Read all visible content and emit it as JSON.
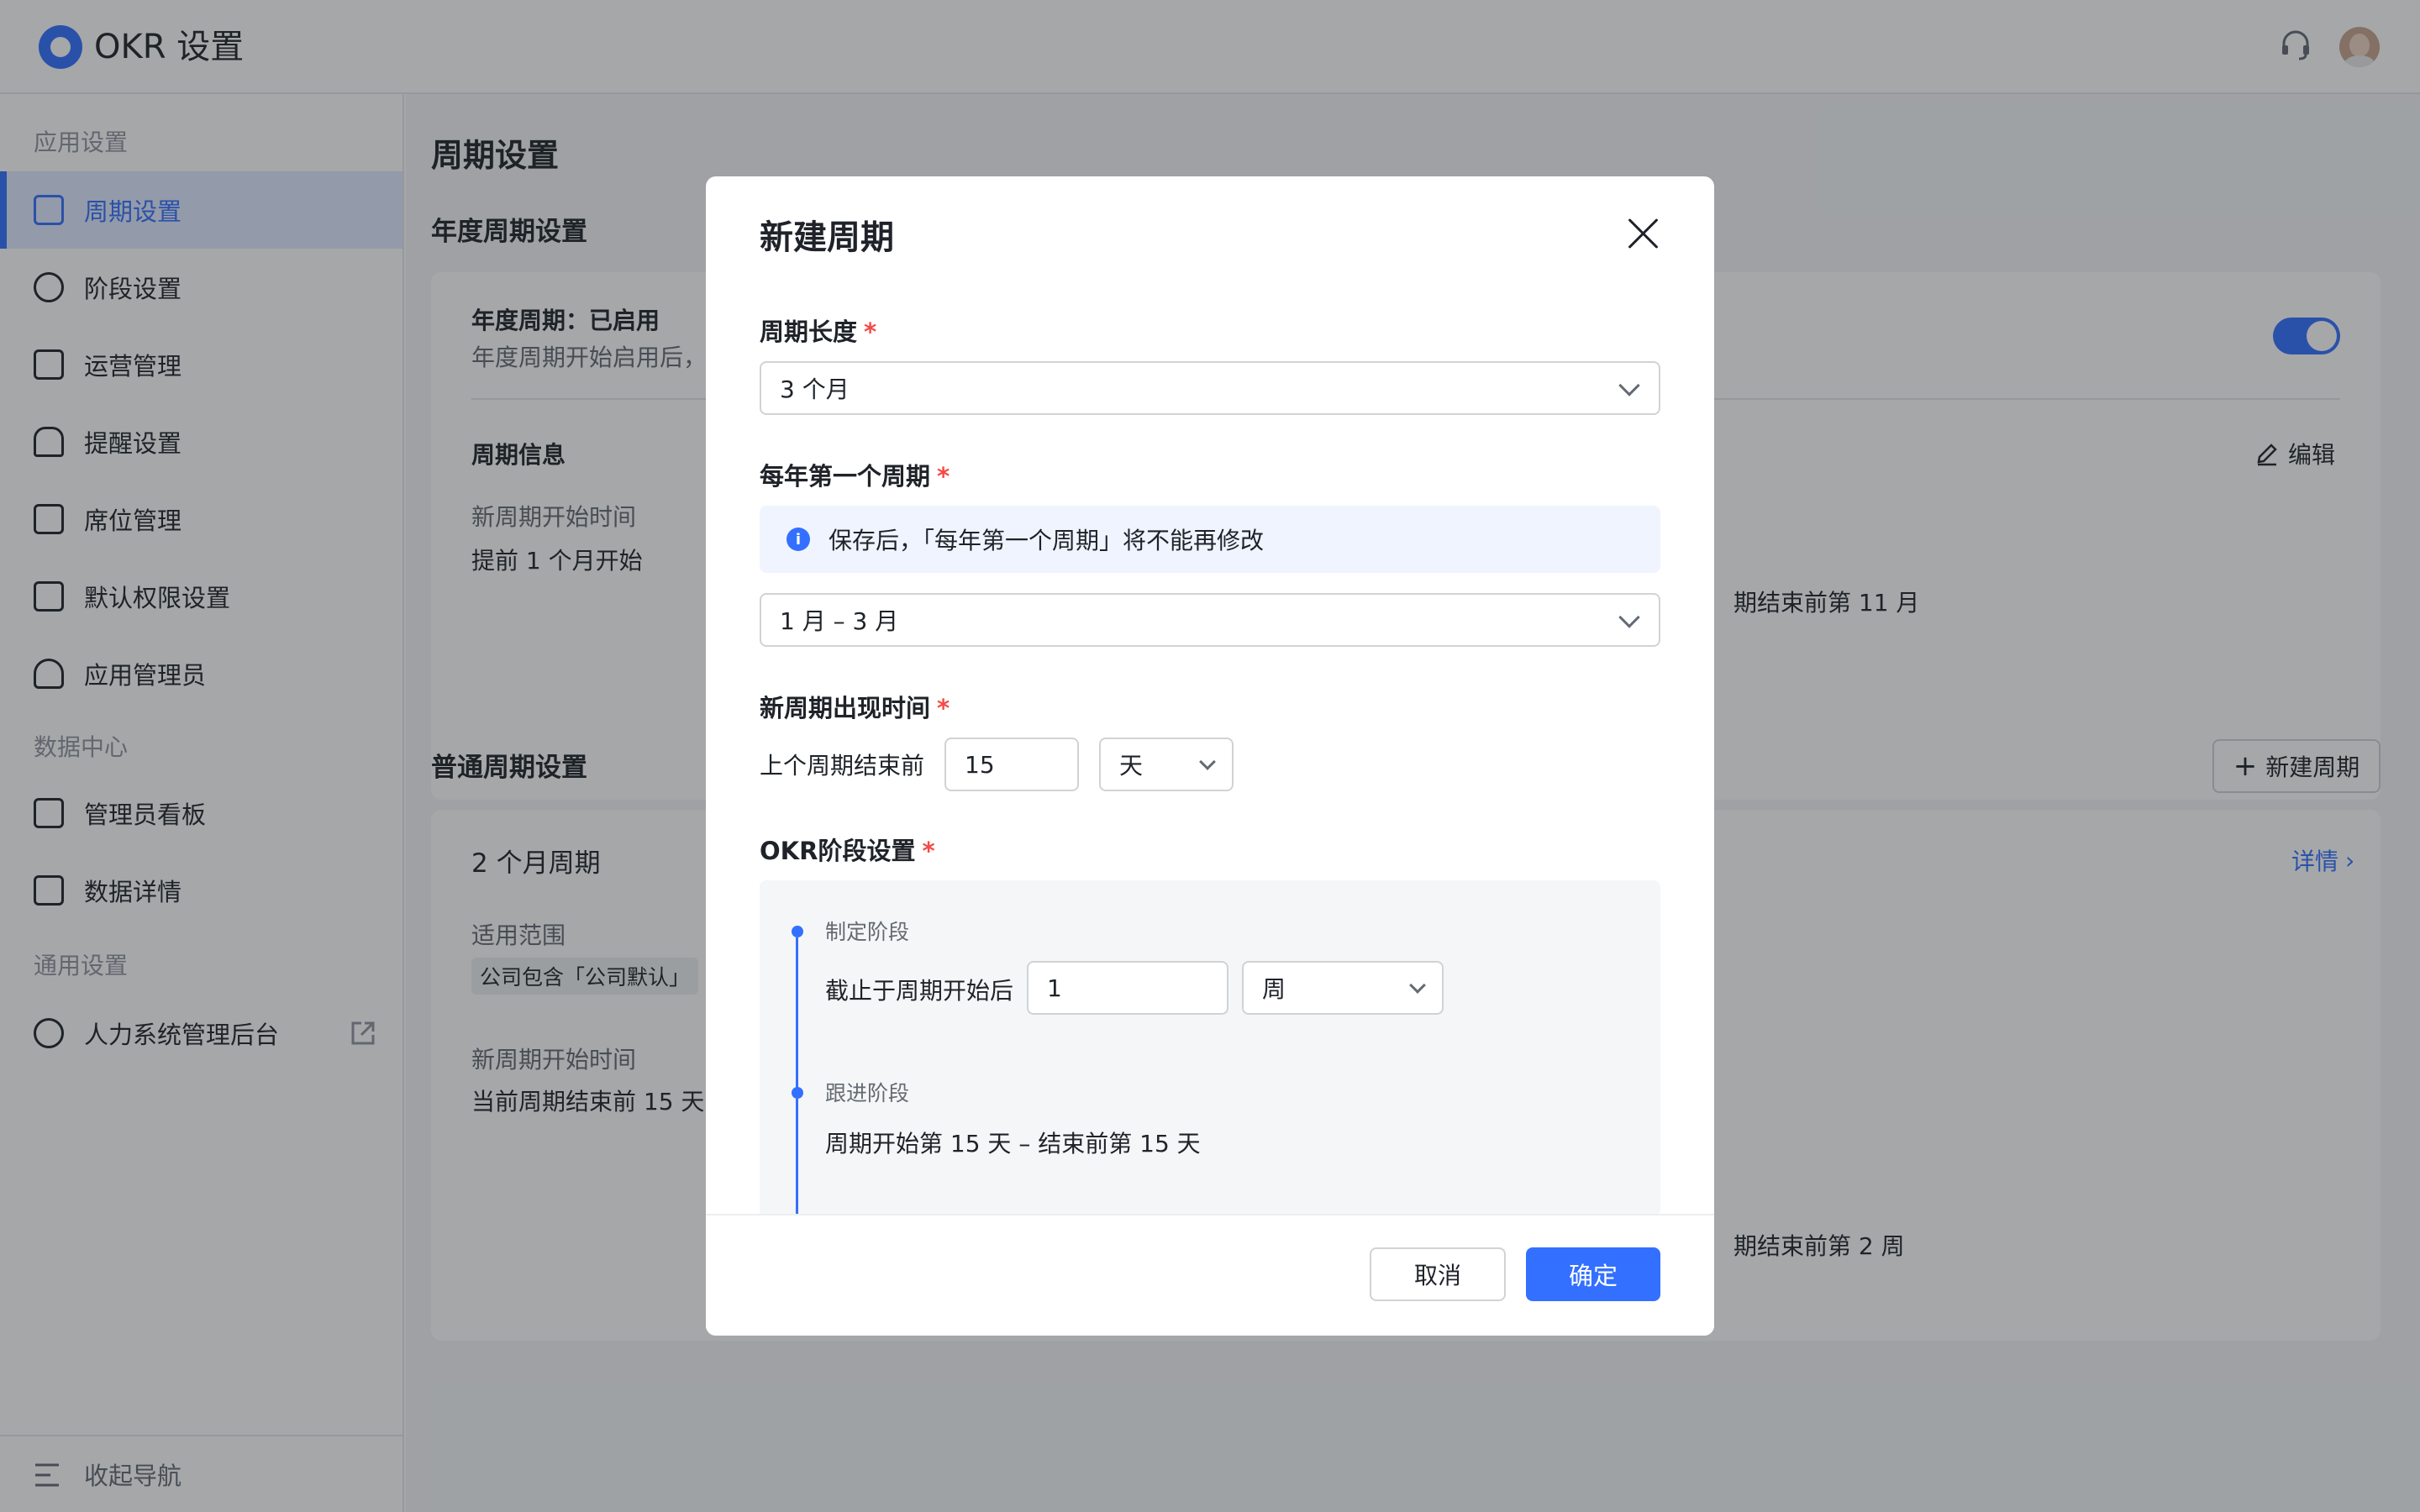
{
  "app": {
    "title": "OKR 设置"
  },
  "sidebar": {
    "sections": [
      {
        "label": "应用设置"
      },
      {
        "label": "数据中心"
      },
      {
        "label": "通用设置"
      }
    ],
    "items": [
      {
        "label": "周期设置",
        "icon": "calendar-settings-icon"
      },
      {
        "label": "阶段设置",
        "icon": "stage-icon"
      },
      {
        "label": "运营管理",
        "icon": "briefcase-icon"
      },
      {
        "label": "提醒设置",
        "icon": "bell-icon"
      },
      {
        "label": "席位管理",
        "icon": "seat-icon"
      },
      {
        "label": "默认权限设置",
        "icon": "lock-icon"
      },
      {
        "label": "应用管理员",
        "icon": "user-icon"
      },
      {
        "label": "管理员看板",
        "icon": "bar-chart-icon"
      },
      {
        "label": "数据详情",
        "icon": "table-icon"
      },
      {
        "label": "人力系统管理后台",
        "icon": "org-icon"
      }
    ],
    "collapse_label": "收起导航"
  },
  "main": {
    "page_title": "周期设置",
    "annual": {
      "section_title": "年度周期设置",
      "status": "年度周期：已启用",
      "desc": "年度周期开始启用后，",
      "info_title": "周期信息",
      "edit_label": "编辑",
      "start_label": "新周期开始时间",
      "start_value": "提前 1 个月开始",
      "right_value": "期结束前第 11 月"
    },
    "normal": {
      "section_title": "普通周期设置",
      "new_button": "新建周期",
      "card_title": "2 个月周期",
      "detail_link": "详情",
      "scope_label": "适用范围",
      "scope_tag": "公司包含「公司默认」",
      "start_label": "新周期开始时间",
      "start_value": "当前周期结束前 15 天",
      "right_value": "期结束前第 2 周"
    }
  },
  "modal": {
    "title": "新建周期",
    "length": {
      "label": "周期长度",
      "value": "3 个月"
    },
    "first": {
      "label": "每年第一个周期",
      "info": "保存后，「每年第一个周期」将不能再修改",
      "value": "1 月 – 3 月"
    },
    "appear": {
      "label": "新周期出现时间",
      "prefix": "上个周期结束前",
      "number": "15",
      "unit": "天"
    },
    "stages": {
      "label": "OKR阶段设置",
      "draft": {
        "name": "制定阶段",
        "prefix": "截止于周期开始后",
        "number": "1",
        "unit": "周"
      },
      "track": {
        "name": "跟进阶段",
        "value": "周期开始第 15 天 – 结束前第 15 天"
      }
    },
    "cancel": "取消",
    "confirm": "确定"
  }
}
